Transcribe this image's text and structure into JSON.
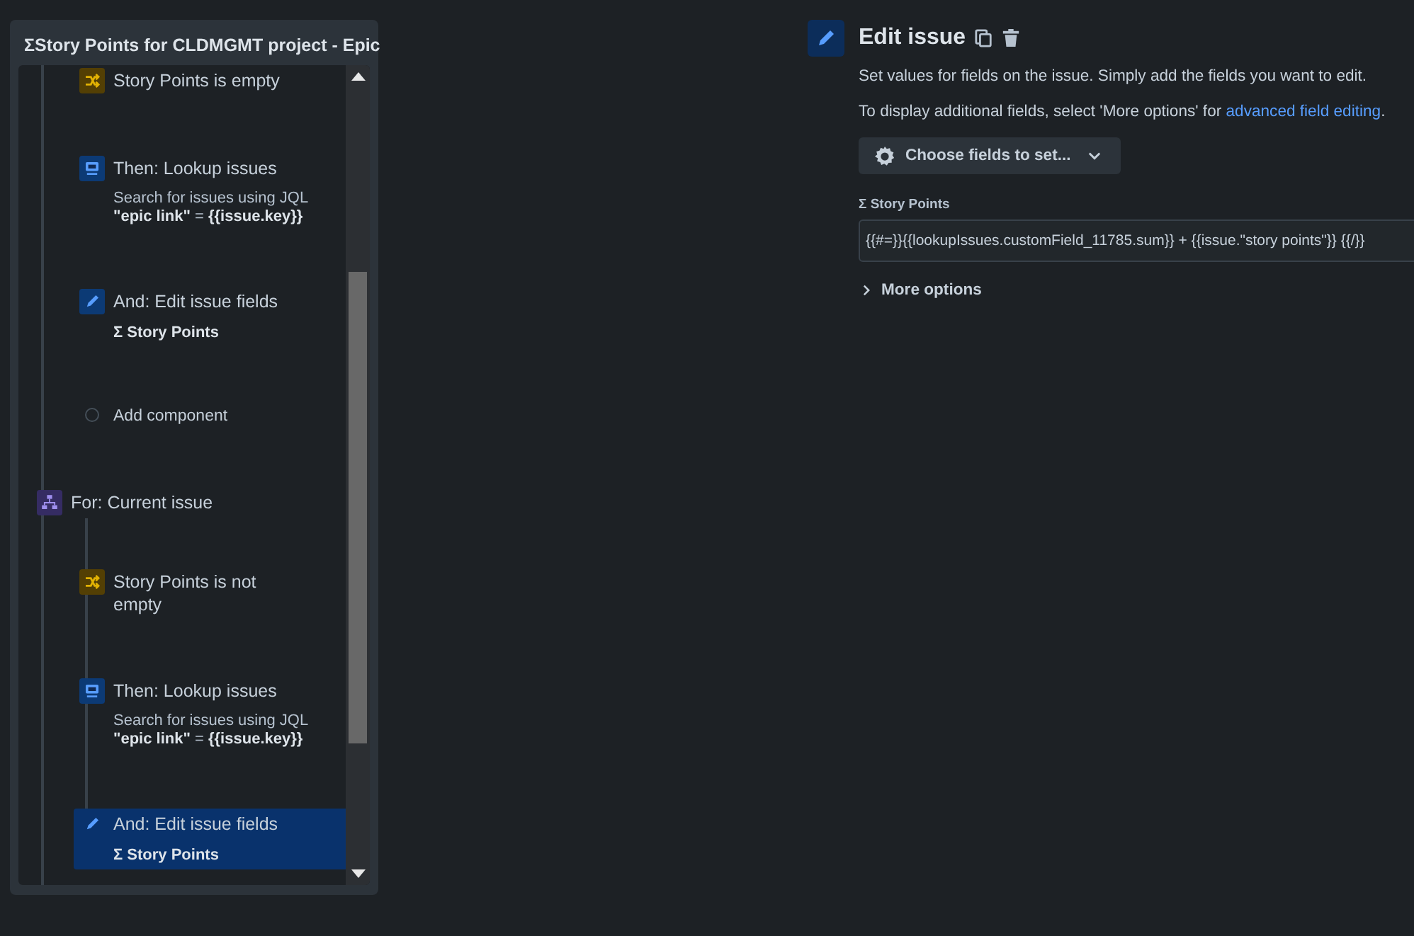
{
  "rule_panel": {
    "title": "ΣStory Points for CLDMGMT project - Epic",
    "items": [
      {
        "kind": "condition",
        "title": "Story Points is empty",
        "selected": false
      },
      {
        "kind": "lookup",
        "title": "Then: Lookup issues",
        "description": [
          "Search for issues using JQL",
          "**\"epic link\"** = **{{issue.key}}**"
        ],
        "selected": false
      },
      {
        "kind": "edit",
        "title": "And: Edit issue fields",
        "detail": "Σ Story Points",
        "selected": false
      },
      {
        "kind": "add",
        "title": "Add component",
        "selected": false
      },
      {
        "kind": "branch",
        "title": "For: Current issue",
        "selected": false,
        "children": [
          {
            "kind": "condition",
            "title": "Story Points is not empty",
            "selected": false
          },
          {
            "kind": "lookup",
            "title": "Then: Lookup issues",
            "description": [
              "Search for issues using JQL",
              "**\"epic link\"** = **{{issue.key}}**"
            ],
            "selected": false
          },
          {
            "kind": "edit",
            "title": "And: Edit issue fields",
            "detail": "Σ Story Points",
            "selected": true
          }
        ]
      }
    ]
  },
  "editor": {
    "title": "Edit issue",
    "intro": "Set values for fields on the issue. Simply add the fields you want to edit.",
    "hint": "To display additional fields, select 'More options' for ",
    "hint_link": "advanced field editing",
    "hint_end": ".",
    "choose_button": "Choose fields to set...",
    "field_label": "Σ Story Points",
    "field_value": "{{#=}}{{lookupIssues.customField_11785.sum}} + {{issue.\"story points\"}} {{/}}",
    "more_options": "More options"
  }
}
